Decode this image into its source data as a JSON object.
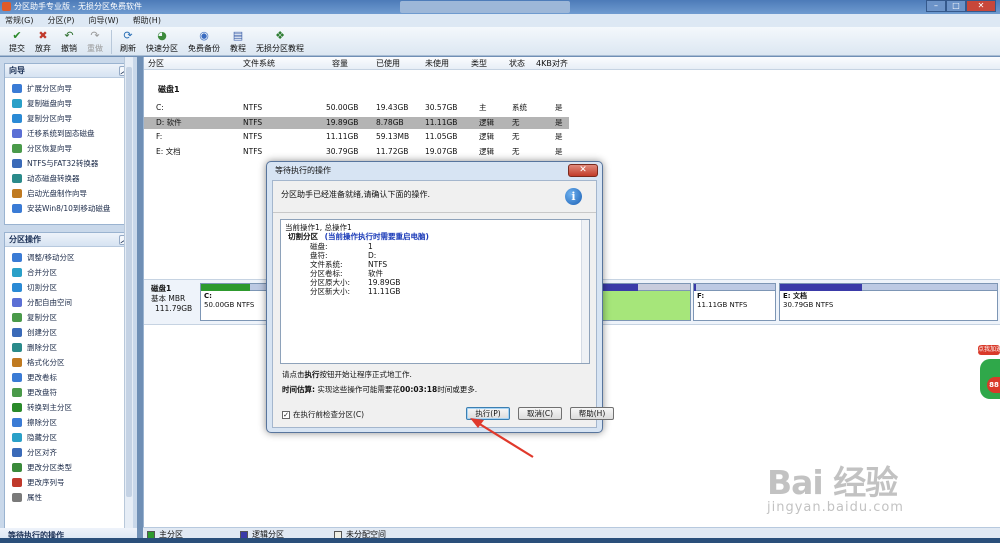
{
  "window": {
    "title": "分区助手专业版 - 无损分区免费软件"
  },
  "menu": [
    "常规(G)",
    "分区(P)",
    "向导(W)",
    "帮助(H)"
  ],
  "toolbar": [
    {
      "label": "提交",
      "icon": "check-icon"
    },
    {
      "label": "放弃",
      "icon": "discard-icon"
    },
    {
      "label": "撤销",
      "icon": "undo-icon"
    },
    {
      "label": "重做",
      "icon": "redo-icon"
    },
    {
      "label": "刷新",
      "icon": "refresh-icon"
    },
    {
      "label": "快速分区",
      "icon": "quick-partition-icon"
    },
    {
      "label": "免费备份",
      "icon": "backup-icon"
    },
    {
      "label": "教程",
      "icon": "tutorial-icon"
    },
    {
      "label": "无损分区教程",
      "icon": "lossless-tutorial-icon"
    }
  ],
  "wizard_section": {
    "title": "向导",
    "items": [
      "扩展分区向导",
      "复制磁盘向导",
      "复制分区向导",
      "迁移系统到固态磁盘",
      "分区恢复向导",
      "NTFS与FAT32转换器",
      "动态磁盘转换器",
      "启动光盘制作向导",
      "安装Win8/10到移动磁盘"
    ]
  },
  "partition_ops_section": {
    "title": "分区操作",
    "items": [
      "调整/移动分区",
      "合并分区",
      "切割分区",
      "分配自由空间",
      "复制分区",
      "创建分区",
      "删除分区",
      "格式化分区",
      "更改卷标",
      "更改盘符",
      "转换到主分区",
      "擦除分区",
      "隐藏分区",
      "分区对齐",
      "更改分区类型",
      "更改序列号",
      "属性"
    ]
  },
  "pending_footer": "等待执行的操作",
  "table": {
    "headers": [
      "分区",
      "文件系统",
      "容量",
      "已使用",
      "未使用",
      "类型",
      "状态",
      "4KB对齐"
    ],
    "disk_label": "磁盘1",
    "rows": [
      {
        "partition": "C:",
        "fs": "NTFS",
        "capacity": "50.00GB",
        "used": "19.43GB",
        "free": "30.57GB",
        "type": "主",
        "status": "系统",
        "align": "是"
      },
      {
        "partition": "D: 软件",
        "fs": "NTFS",
        "capacity": "19.89GB",
        "used": "8.78GB",
        "free": "11.11GB",
        "type": "逻辑",
        "status": "无",
        "align": "是"
      },
      {
        "partition": "F:",
        "fs": "NTFS",
        "capacity": "11.11GB",
        "used": "59.13MB",
        "free": "11.05GB",
        "type": "逻辑",
        "status": "无",
        "align": "是"
      },
      {
        "partition": "E: 文档",
        "fs": "NTFS",
        "capacity": "30.79GB",
        "used": "11.72GB",
        "free": "19.07GB",
        "type": "逻辑",
        "status": "无",
        "align": "是"
      }
    ]
  },
  "diskmap": {
    "disk": "磁盘1",
    "kind": "基本 MBR",
    "size": "111.79GB",
    "partitions": [
      {
        "label": "C:",
        "detail": "50.00GB NTFS",
        "used_fraction": 0.39
      },
      {
        "label": "F:",
        "detail": "11.11GB NTFS",
        "used_fraction": 0.01
      },
      {
        "label": "E: 文档",
        "detail": "30.79GB NTFS",
        "used_fraction": 0.38
      }
    ]
  },
  "legend": [
    "主分区",
    "逻辑分区",
    "未分配空间"
  ],
  "dialog": {
    "title": "等待执行的操作",
    "message": "分区助手已经准备就绪,请确认下面的操作.",
    "op_header": "当前操作1, 总操作1",
    "op_title": "切割分区",
    "op_note": "(当前操作执行时需要重启电脑)",
    "details": [
      {
        "k": "磁盘:",
        "v": "1"
      },
      {
        "k": "盘符:",
        "v": "D:"
      },
      {
        "k": "文件系统:",
        "v": "NTFS"
      },
      {
        "k": "分区卷标:",
        "v": "软件"
      },
      {
        "k": "分区原大小:",
        "v": "19.89GB"
      },
      {
        "k": "分区新大小:",
        "v": "11.11GB"
      }
    ],
    "note_pre": "请点击",
    "note_bold": "执行",
    "note_post": "按钮开始让程序正式地工作.",
    "time_label": "时间估算:",
    "time_pre": " 实现这些操作可能需要花",
    "time_value": "00:03:18",
    "time_post": "时间或更多.",
    "check_label": "在执行前检查分区(C)",
    "buttons": {
      "execute": "执行(P)",
      "cancel": "取消(C)",
      "help": "帮助(H)"
    }
  },
  "widget": {
    "tag": "点我加速",
    "num": "88"
  },
  "watermark": {
    "big": "Bai 经验",
    "small": "jingyan.baidu.com"
  },
  "colors": {
    "primary_partition": "#2e9a2e",
    "logical_partition": "#3a3aa8",
    "selected_partition": "#a6e67a"
  }
}
